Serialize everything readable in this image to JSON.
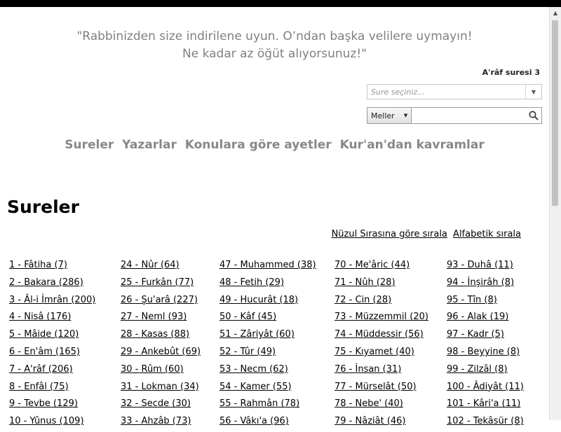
{
  "quote": {
    "line1": "\"Rabbinizden size indirilene uyun. O’ndan başka velilere uymayın!",
    "line2": "Ne kadar az öğüt alıyorsunuz!\"",
    "source": "A'râf suresi 3"
  },
  "sure_select": {
    "placeholder": "Sure seçiniz..."
  },
  "search": {
    "mode_label": "Meller",
    "value": ""
  },
  "nav": {
    "sureler": "Sureler",
    "yazarlar": "Yazarlar",
    "konular": "Konulara göre ayetler",
    "kavramlar": "Kur'an'dan kavramlar"
  },
  "page_title": "Sureler",
  "sort": {
    "nuzul": "Nüzul Sırasına göre sırala",
    "alfabetik": "Alfabetik sırala"
  },
  "columns": [
    [
      "1 - Fâtiha (7)",
      "2 - Bakara (286)",
      "3 - Âl-i İmrân (200)",
      "4 - Nisâ (176)",
      "5 - Mâide (120)",
      "6 - En'âm (165)",
      "7 - A'râf (206)",
      "8 - Enfâl (75)",
      "9 - Tevbe (129)",
      "10 - Yûnus (109)"
    ],
    [
      "24 - Nûr (64)",
      "25 - Furkân (77)",
      "26 - Şu'arâ (227)",
      "27 - Neml (93)",
      "28 - Kasas (88)",
      "29 - Ankebût (69)",
      "30 - Rûm (60)",
      "31 - Lokman (34)",
      "32 - Secde (30)",
      "33 - Ahzâb (73)"
    ],
    [
      "47 - Muhammed (38)",
      "48 - Fetih (29)",
      "49 - Hucurât (18)",
      "50 - Kâf (45)",
      "51 - Zâriyât (60)",
      "52 - Tûr (49)",
      "53 - Necm (62)",
      "54 - Kamer (55)",
      "55 - Rahmân (78)",
      "56 - Vâkı'a (96)"
    ],
    [
      "70 - Me'âric (44)",
      "71 - Nûh (28)",
      "72 - Cin (28)",
      "73 - Müzzemmil (20)",
      "74 - Müddessir (56)",
      "75 - Kıyamet (40)",
      "76 - İnsan (31)",
      "77 - Mürselât (50)",
      "78 - Nebe' (40)",
      "79 - Nâziât (46)"
    ],
    [
      "93 - Duhâ (11)",
      "94 - İnşirâh (8)",
      "95 - Tîn (8)",
      "96 - Alak (19)",
      "97 - Kadr (5)",
      "98 - Beyyine (8)",
      "99 - Zilzâl (8)",
      "100 - Âdiyât (11)",
      "101 - Kâri'a (11)",
      "102 - Tekâsür (8)"
    ]
  ]
}
